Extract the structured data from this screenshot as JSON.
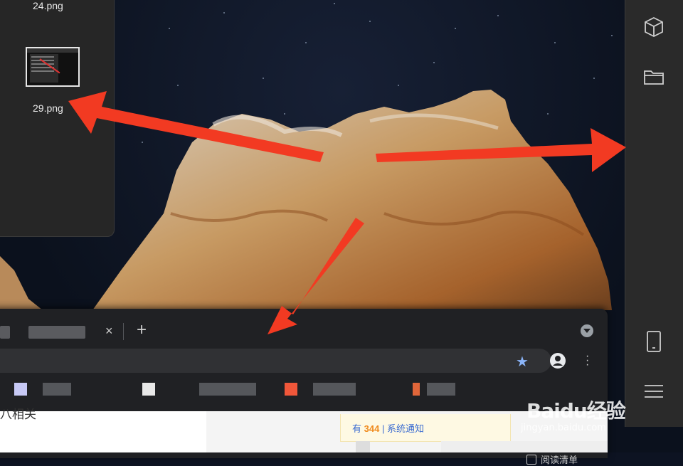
{
  "desktop": {
    "files": [
      {
        "name": "24.png"
      },
      {
        "name": "29.png"
      }
    ]
  },
  "dock": {
    "icons": [
      "cube-icon",
      "folder-icon",
      "phone-icon",
      "hamburger-icon"
    ]
  },
  "browser": {
    "tab_close": "×",
    "new_tab": "+",
    "reader_mode": "阅读清单"
  },
  "page": {
    "related": "八相关",
    "notice_prefix": "有",
    "notice_count": "344",
    "notice_sep": "|",
    "notice_text": "系统通知"
  },
  "watermark": {
    "logo": "Baidu经验",
    "url": "jingyan.baidu.com"
  },
  "colors": {
    "arrow": "#f23a22",
    "accent_star": "#8ab4f8",
    "notice_count": "#f08a1c"
  }
}
